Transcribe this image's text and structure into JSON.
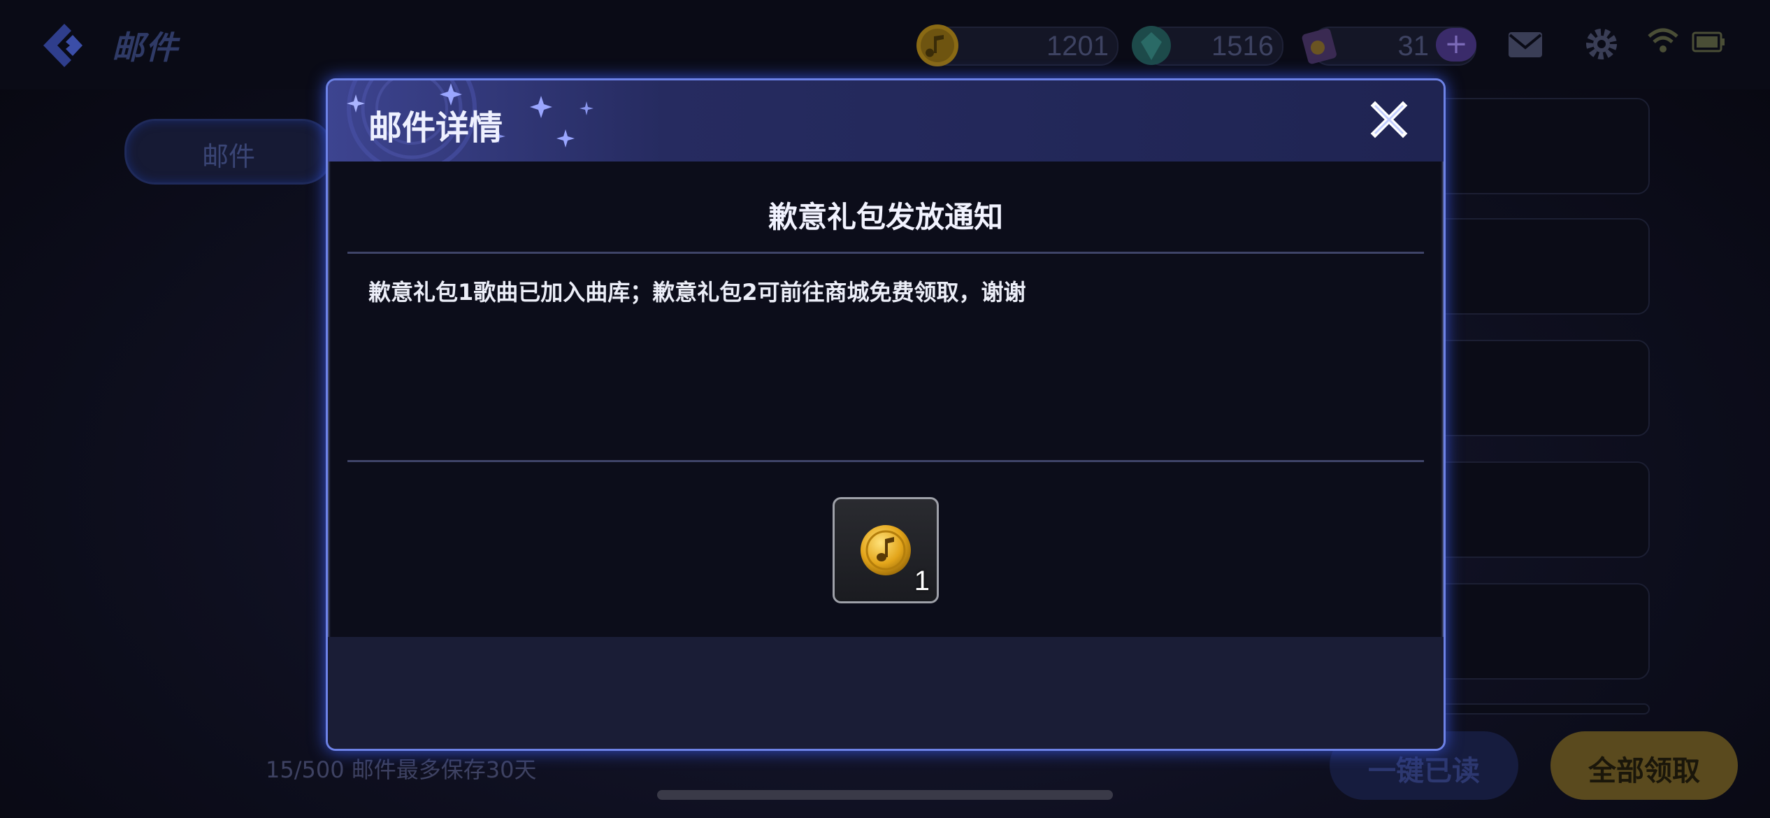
{
  "header": {
    "title": "邮件",
    "currencies": [
      {
        "name": "coin",
        "value": "1201"
      },
      {
        "name": "gem",
        "value": "1516"
      },
      {
        "name": "ticket",
        "value": "31",
        "plus": "+"
      }
    ],
    "icons": [
      "mail-icon",
      "gear-icon",
      "wifi-icon",
      "battery-icon"
    ]
  },
  "sidebar": {
    "tab_label": "邮件"
  },
  "footer": {
    "info": "15/500 邮件最多保存30天",
    "read_all_label": "一键已读",
    "claim_all_label": "全部领取"
  },
  "modal": {
    "title": "邮件详情",
    "subject": "歉意礼包发放通知",
    "body": "歉意礼包1歌曲已加入曲库；歉意礼包2可前往商城免费领取，谢谢",
    "reward": {
      "icon": "music-coin-icon",
      "count": "1"
    }
  },
  "colors": {
    "accent": "#6d82e6",
    "gold": "#e3a51a"
  }
}
